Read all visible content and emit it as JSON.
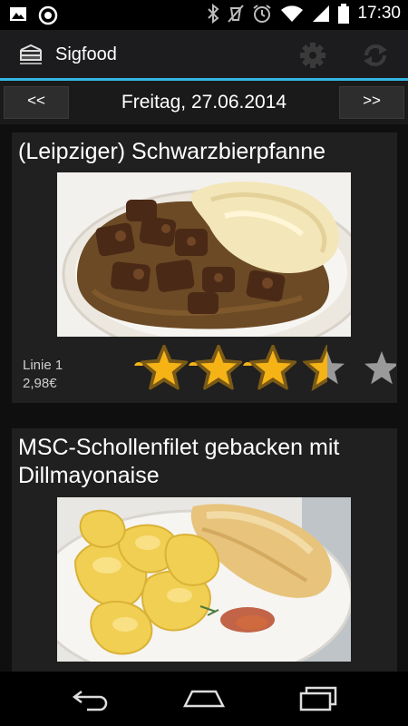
{
  "status_bar": {
    "time": "17:30",
    "icons": [
      "gallery-icon",
      "sync-circle-icon",
      "bluetooth-icon",
      "mute-icon",
      "alarm-icon",
      "wifi-icon",
      "signal-icon",
      "battery-icon"
    ]
  },
  "action_bar": {
    "title": "Sigfood",
    "icons": [
      "app-logo-icon",
      "gear-icon",
      "refresh-icon"
    ],
    "accent_color": "#33b5e5"
  },
  "date_nav": {
    "prev_label": "<<",
    "date": "Freitag, 27.06.2014",
    "next_label": ">>"
  },
  "meals": [
    {
      "title": "(Leipziger) Schwarzbierpfanne",
      "line": "Linie 1",
      "price": "2,98€",
      "rating": 3.5,
      "rating_max": 5
    },
    {
      "title": "MSC-Schollenfilet gebacken mit Dillmayonaise"
    }
  ],
  "nav_bar": {
    "icons": [
      "back-icon",
      "home-icon",
      "recent-apps-icon"
    ]
  },
  "colors": {
    "star_fill": "#f5b316",
    "star_outline": "#7a5a16",
    "star_empty": "#9a9a9a",
    "card_bg": "#202020"
  }
}
